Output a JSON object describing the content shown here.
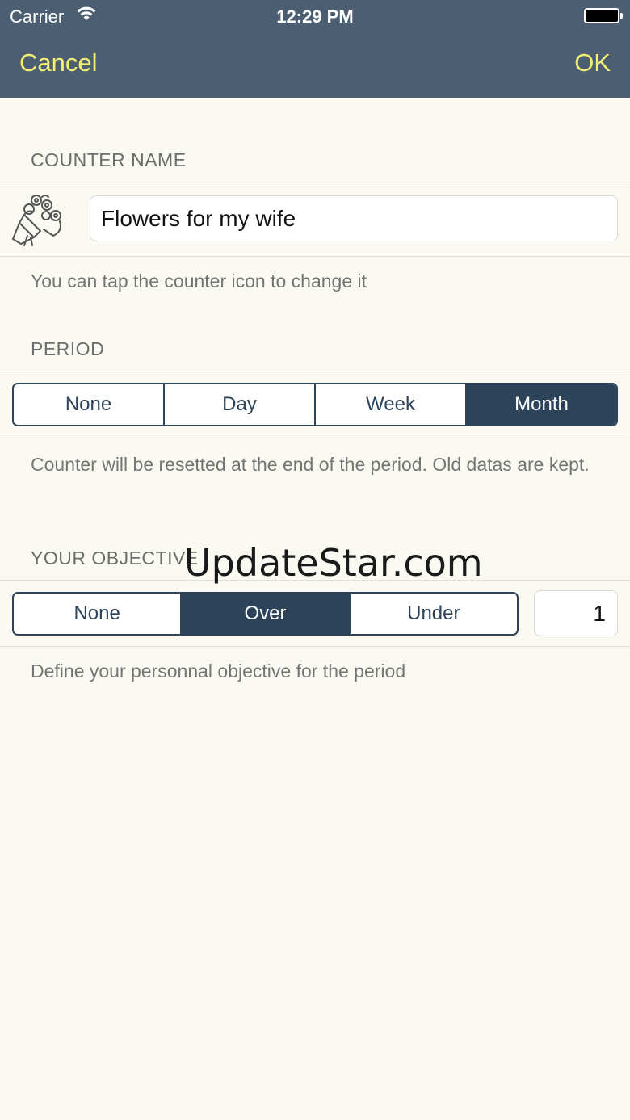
{
  "status_bar": {
    "carrier": "Carrier",
    "time": "12:29 PM"
  },
  "nav": {
    "cancel_label": "Cancel",
    "ok_label": "OK"
  },
  "counter_name": {
    "header": "COUNTER NAME",
    "value": "Flowers for my wife",
    "icon": "bouquet-icon",
    "footer": "You can tap the counter icon to change it"
  },
  "period": {
    "header": "PERIOD",
    "options": [
      "None",
      "Day",
      "Week",
      "Month"
    ],
    "selected": "Month",
    "footer": "Counter will be resetted at the end of the period. Old datas are kept."
  },
  "objective": {
    "header": "YOUR OBJECTIVE",
    "options": [
      "None",
      "Over",
      "Under"
    ],
    "selected": "Over",
    "value": "1",
    "footer": "Define your personnal objective for the period"
  },
  "watermark": "UpdateStar.com",
  "colors": {
    "navbar": "#4b5e72",
    "nav_text": "#f3ef70",
    "accent": "#2c4359",
    "background": "#fbfaf2"
  }
}
